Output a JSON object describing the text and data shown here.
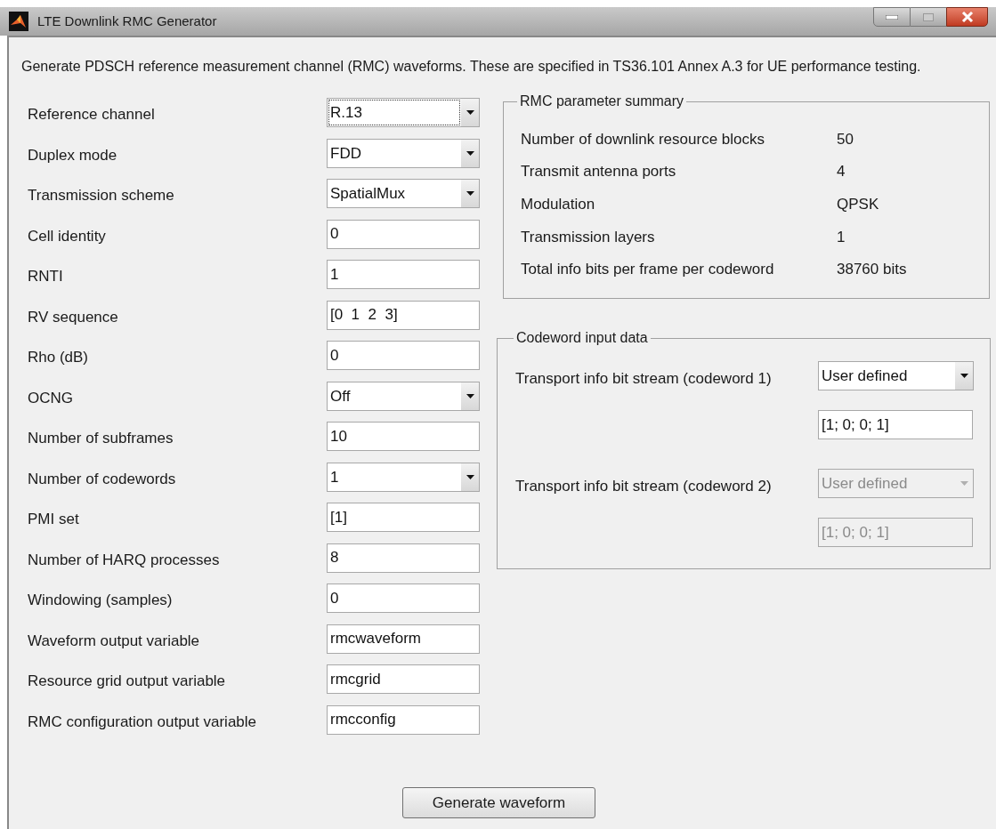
{
  "window": {
    "title": "LTE Downlink RMC Generator"
  },
  "description": "Generate PDSCH reference measurement channel (RMC) waveforms. These are specified in TS36.101 Annex A.3 for UE performance testing.",
  "fields": [
    {
      "label": "Reference channel",
      "kind": "dropdown",
      "value": "R.13",
      "focused": true
    },
    {
      "label": "Duplex mode",
      "kind": "dropdown",
      "value": "FDD",
      "focused": false
    },
    {
      "label": "Transmission scheme",
      "kind": "dropdown",
      "value": "SpatialMux",
      "focused": false
    },
    {
      "label": "Cell identity",
      "kind": "text",
      "value": "0",
      "focused": false
    },
    {
      "label": "RNTI",
      "kind": "text",
      "value": "1",
      "focused": false
    },
    {
      "label": "RV sequence",
      "kind": "text",
      "value": "[0  1  2  3]",
      "focused": false
    },
    {
      "label": "Rho (dB)",
      "kind": "text",
      "value": "0",
      "focused": false
    },
    {
      "label": "OCNG",
      "kind": "dropdown",
      "value": "Off",
      "focused": false
    },
    {
      "label": "Number of subframes",
      "kind": "text",
      "value": "10",
      "focused": false
    },
    {
      "label": "Number of codewords",
      "kind": "dropdown",
      "value": "1",
      "focused": false
    },
    {
      "label": "PMI set",
      "kind": "text",
      "value": "[1]",
      "focused": false
    },
    {
      "label": "Number of HARQ processes",
      "kind": "text",
      "value": "8",
      "focused": false
    },
    {
      "label": "Windowing (samples)",
      "kind": "text",
      "value": "0",
      "focused": false
    },
    {
      "label": "Waveform output variable",
      "kind": "text",
      "value": "rmcwaveform",
      "focused": false
    },
    {
      "label": "Resource grid output variable",
      "kind": "text",
      "value": "rmcgrid",
      "focused": false
    },
    {
      "label": "RMC configuration output variable",
      "kind": "text",
      "value": "rmcconfig",
      "focused": false
    }
  ],
  "summary": {
    "title": "RMC parameter summary",
    "rows": [
      {
        "label": "Number of downlink resource blocks",
        "value": "50"
      },
      {
        "label": "Transmit antenna ports",
        "value": "4"
      },
      {
        "label": "Modulation",
        "value": "QPSK"
      },
      {
        "label": "Transmission layers",
        "value": "1"
      },
      {
        "label": "Total info bits per frame per codeword",
        "value": "38760 bits"
      }
    ]
  },
  "codeword": {
    "title": "Codeword input data",
    "streams": [
      {
        "label": "Transport info bit stream (codeword 1)",
        "source": "User defined",
        "bits": "[1; 0; 0; 1]",
        "disabled": false
      },
      {
        "label": "Transport info bit stream (codeword 2)",
        "source": "User defined",
        "bits": "[1; 0; 0; 1]",
        "disabled": true
      }
    ]
  },
  "generate_button": "Generate waveform"
}
